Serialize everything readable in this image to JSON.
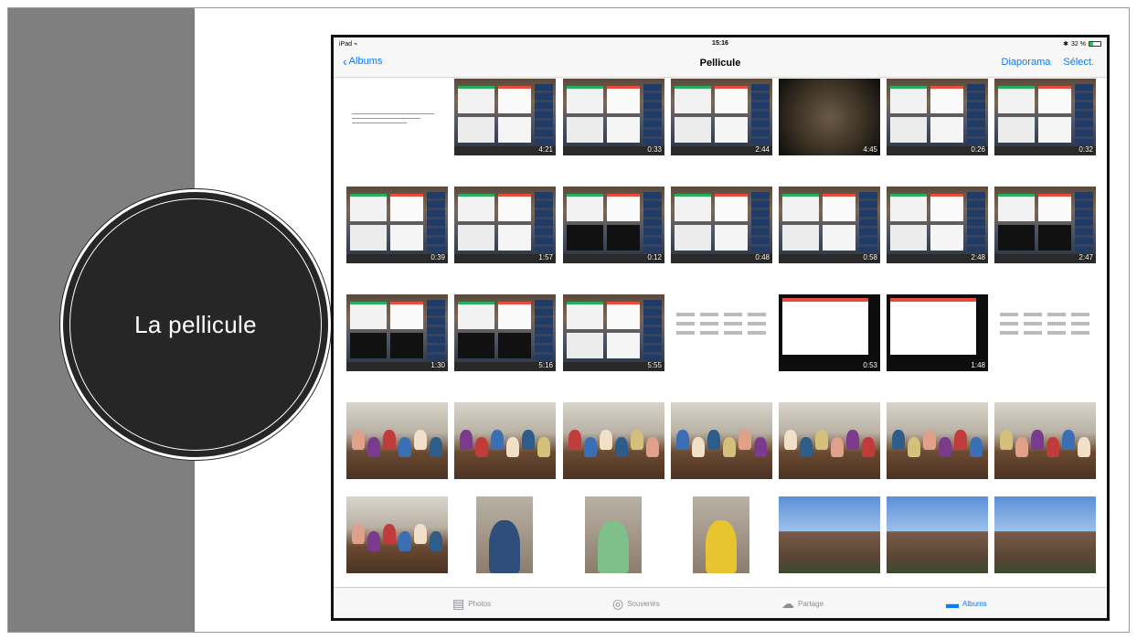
{
  "slide": {
    "title": "La pellicule",
    "colors": {
      "sidebar": "#7f7f7f",
      "circle": "#262626",
      "accent": "#0a7aff"
    }
  },
  "ipad": {
    "status": {
      "device": "iPad",
      "time": "15:16",
      "battery": "32 %",
      "battery_level": 0.32
    },
    "nav": {
      "back_label": "Albums",
      "title": "Pellicule",
      "slideshow_label": "Diaporama",
      "select_label": "Sélect."
    },
    "rows": [
      [
        {
          "kind": "doc",
          "duration": ""
        },
        {
          "kind": "screen",
          "duration": "4:21"
        },
        {
          "kind": "screen",
          "duration": "0:33"
        },
        {
          "kind": "screen",
          "duration": "2:44"
        },
        {
          "kind": "aerial",
          "duration": "4:45"
        },
        {
          "kind": "screen",
          "duration": "0:26"
        },
        {
          "kind": "screen",
          "duration": "0:32"
        }
      ],
      [
        {
          "kind": "screen",
          "duration": "0:39"
        },
        {
          "kind": "screen",
          "duration": "1:57"
        },
        {
          "kind": "screen-dark",
          "duration": "0:12"
        },
        {
          "kind": "screen",
          "duration": "0:48"
        },
        {
          "kind": "screen",
          "duration": "0:58"
        },
        {
          "kind": "screen",
          "duration": "2:48"
        },
        {
          "kind": "screen-dark",
          "duration": "2:47"
        }
      ],
      [
        {
          "kind": "screen-dark",
          "duration": "1:30"
        },
        {
          "kind": "screen-dark",
          "duration": "5:16"
        },
        {
          "kind": "screen",
          "duration": "5:55"
        },
        {
          "kind": "sheet",
          "duration": ""
        },
        {
          "kind": "red",
          "duration": "0:53"
        },
        {
          "kind": "red",
          "duration": "1:48"
        },
        {
          "kind": "sheet",
          "duration": ""
        }
      ],
      [
        {
          "kind": "room",
          "duration": ""
        },
        {
          "kind": "room",
          "duration": ""
        },
        {
          "kind": "room",
          "duration": ""
        },
        {
          "kind": "room",
          "duration": ""
        },
        {
          "kind": "room",
          "duration": ""
        },
        {
          "kind": "room",
          "duration": ""
        },
        {
          "kind": "room",
          "duration": ""
        }
      ],
      [
        {
          "kind": "room",
          "duration": ""
        },
        {
          "kind": "portrait",
          "duration": ""
        },
        {
          "kind": "portrait",
          "duration": ""
        },
        {
          "kind": "portrait",
          "duration": ""
        },
        {
          "kind": "building",
          "duration": ""
        },
        {
          "kind": "building",
          "duration": ""
        },
        {
          "kind": "building",
          "duration": ""
        }
      ]
    ],
    "tabs": [
      {
        "label": "Photos",
        "icon": "photos-icon",
        "active": false
      },
      {
        "label": "Souvenirs",
        "icon": "memories-icon",
        "active": false
      },
      {
        "label": "Partage",
        "icon": "cloud-icon",
        "active": false
      },
      {
        "label": "Albums",
        "icon": "albums-icon",
        "active": true
      }
    ]
  }
}
